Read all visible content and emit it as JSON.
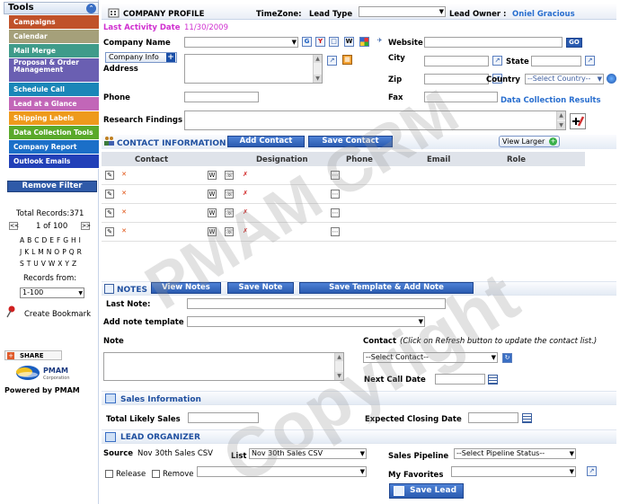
{
  "sidebar": {
    "title": "Tools",
    "items": [
      {
        "label": "Campaigns",
        "color": "#c0522a"
      },
      {
        "label": "Calendar",
        "color": "#a5a07a"
      },
      {
        "label": "Mail Merge",
        "color": "#3f9b8a"
      },
      {
        "label": "Proposal & Order Management",
        "color": "#6a5fb2"
      },
      {
        "label": "Schedule Call",
        "color": "#1a86b8"
      },
      {
        "label": "Lead at a Glance",
        "color": "#c266b8"
      },
      {
        "label": "Shipping Labels",
        "color": "#ee9a1c"
      },
      {
        "label": "Data Collection Tools",
        "color": "#5aa92a"
      },
      {
        "label": "Company Report",
        "color": "#1b6fc8"
      },
      {
        "label": "Outlook Emails",
        "color": "#2240b8"
      }
    ],
    "remove_filter": "Remove Filter",
    "total_records": "Total Records:371",
    "page_indicator": "1 of 100",
    "prev": "<<",
    "next": ">>",
    "alpha_rows": [
      "A B C D E F G H I",
      "J K L M N O P Q R",
      "S T U V W X Y Z"
    ],
    "records_from_label": "Records from:",
    "records_from_value": "1-100",
    "create_bookmark": "Create Bookmark",
    "share": "SHARE",
    "pmam_logo": "PMAM",
    "pmam_corp": "Corporation",
    "powered_by": "Powered by PMAM"
  },
  "header": {
    "title": "COMPANY PROFILE",
    "timezone_label": "TimeZone:",
    "lead_type_label": "Lead Type",
    "lead_owner_label": "Lead Owner :",
    "lead_owner_value": "Oniel Gracious",
    "last_activity_label": "Last Activity Date",
    "last_activity_value": "11/30/2009"
  },
  "company": {
    "name_label": "Company Name",
    "info_button": "Company Info",
    "address_label": "Address",
    "website_label": "Website",
    "go": "GO",
    "city_label": "City",
    "state_label": "State",
    "zip_label": "Zip",
    "country_label": "Country",
    "country_placeholder": "--Select Country--",
    "phone_label": "Phone",
    "fax_label": "Fax",
    "data_collection_link": "Data Collection Results",
    "research_label": "Research Findings",
    "search_icons": [
      "G",
      "Y",
      "W"
    ]
  },
  "contact": {
    "section_title": "CONTACT INFORMATION",
    "add_button": "Add Contact",
    "save_button": "Save Contact",
    "view_larger": "View Larger",
    "columns": [
      "Contact",
      "Designation",
      "Phone",
      "Email",
      "Role"
    ],
    "row_count": 4
  },
  "notes": {
    "section_title": "NOTES",
    "view_notes": "View Notes",
    "save_note": "Save Note",
    "save_template": "Save Template & Add Note",
    "last_note_label": "Last Note:",
    "add_template_label": "Add note template",
    "note_label": "Note",
    "contact_label": "Contact",
    "contact_hint": "(Click on Refresh button to update the contact list.)",
    "select_contact": "--Select Contact--",
    "next_call_label": "Next Call Date"
  },
  "sales": {
    "section_title": "Sales Information",
    "total_likely_label": "Total Likely Sales",
    "expected_closing_label": "Expected Closing Date"
  },
  "lead": {
    "section_title": "LEAD ORGANIZER",
    "source_label": "Source",
    "source_value": "Nov 30th Sales CSV",
    "list_label": "List",
    "list_value": "Nov 30th Sales CSV",
    "pipeline_label": "Sales Pipeline",
    "pipeline_value": "--Select Pipeline Status--",
    "release_label": "Release",
    "remove_label": "Remove",
    "favorites_label": "My Favorites",
    "save_lead": "Save Lead"
  },
  "watermark": {
    "line1": "PMAM CRM",
    "line2": "Copyright"
  }
}
